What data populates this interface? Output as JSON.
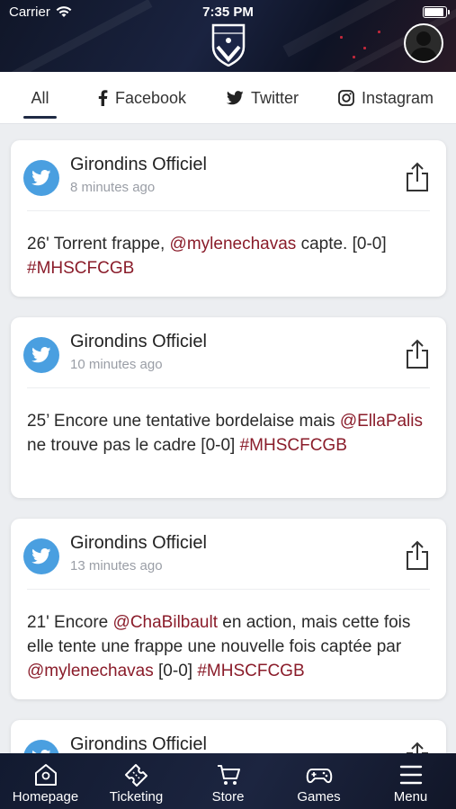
{
  "status": {
    "carrier": "Carrier",
    "time": "7:35 PM"
  },
  "tabs": [
    {
      "label": "All",
      "icon": "none",
      "active": true
    },
    {
      "label": "Facebook",
      "icon": "facebook-icon"
    },
    {
      "label": "Twitter",
      "icon": "twitter-icon"
    },
    {
      "label": "Instagram",
      "icon": "instagram-icon"
    }
  ],
  "posts": [
    {
      "author": "Girondins Officiel",
      "time": "8 minutes ago",
      "segments": [
        {
          "t": "26' Torrent frappe, "
        },
        {
          "t": "@mylenechavas",
          "m": true
        },
        {
          "t": " capte. [0-0] "
        },
        {
          "t": "#MHSCFCGB",
          "m": true
        }
      ]
    },
    {
      "author": "Girondins Officiel",
      "time": "10 minutes ago",
      "segments": [
        {
          "t": "25’ Encore une tentative bordelaise mais "
        },
        {
          "t": "@EllaPalis",
          "m": true
        },
        {
          "t": " ne trouve pas le cadre [0-0] "
        },
        {
          "t": "#MHSCFCGB",
          "m": true
        }
      ]
    },
    {
      "author": "Girondins Officiel",
      "time": "13 minutes ago",
      "segments": [
        {
          "t": "21' Encore "
        },
        {
          "t": "@ChaBilbault",
          "m": true
        },
        {
          "t": " en action, mais cette fois elle tente une frappe une nouvelle fois captée par "
        },
        {
          "t": "@mylenechavas",
          "m": true
        },
        {
          "t": " [0-0] "
        },
        {
          "t": "#MHSCFCGB",
          "m": true
        }
      ]
    },
    {
      "author": "Girondins Officiel",
      "time": "",
      "segments": []
    }
  ],
  "nav": [
    {
      "label": "Homepage",
      "icon": "home-icon"
    },
    {
      "label": "Ticketing",
      "icon": "ticket-icon"
    },
    {
      "label": "Store",
      "icon": "cart-icon"
    },
    {
      "label": "Games",
      "icon": "gamepad-icon"
    },
    {
      "label": "Menu",
      "icon": "menu-icon"
    }
  ],
  "colors": {
    "mention": "#8a1c2a",
    "twitter": "#4a9fe0",
    "navy": "#1a2340"
  }
}
